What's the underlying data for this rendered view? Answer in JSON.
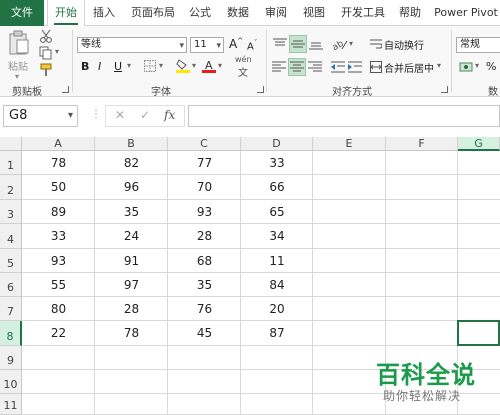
{
  "tabs": [
    {
      "label": "文件"
    },
    {
      "label": "开始"
    },
    {
      "label": "插入"
    },
    {
      "label": "页面布局"
    },
    {
      "label": "公式"
    },
    {
      "label": "数据"
    },
    {
      "label": "审阅"
    },
    {
      "label": "视图"
    },
    {
      "label": "开发工具"
    },
    {
      "label": "帮助"
    },
    {
      "label": "Power Pivot"
    }
  ],
  "ribbon": {
    "paste_label": "粘贴",
    "clipboard_group": "剪贴板",
    "font_name": "等线",
    "font_size": "11",
    "grow_font": "A",
    "shrink_font": "A",
    "bold": "B",
    "italic": "I",
    "underline": "U",
    "wen_label": "wén",
    "font_group": "字体",
    "wrap_text": "自动换行",
    "merge_center": "合并后居中",
    "align_group": "对齐方式",
    "number_format": "常规",
    "percent": "%",
    "number_group": "数"
  },
  "formula_bar": {
    "name_box": "G8",
    "cancel": "✕",
    "confirm": "✓",
    "fx": "fx",
    "formula": ""
  },
  "sheet": {
    "columns": [
      "A",
      "B",
      "C",
      "D",
      "E",
      "F",
      "G"
    ],
    "rows": [
      "1",
      "2",
      "3",
      "4",
      "5",
      "6",
      "7",
      "8",
      "9",
      "10",
      "11"
    ],
    "selected_cell": "G8",
    "data": [
      [
        "78",
        "82",
        "77",
        "33"
      ],
      [
        "50",
        "96",
        "70",
        "66"
      ],
      [
        "89",
        "35",
        "93",
        "65"
      ],
      [
        "33",
        "24",
        "28",
        "34"
      ],
      [
        "93",
        "91",
        "68",
        "11"
      ],
      [
        "55",
        "97",
        "35",
        "84"
      ],
      [
        "80",
        "28",
        "76",
        "20"
      ],
      [
        "22",
        "78",
        "45",
        "87"
      ]
    ]
  },
  "watermark": {
    "title": "百科全说",
    "subtitle": "助你轻松解决"
  },
  "colors": {
    "accent": "#217346",
    "watermark": "#1a9a4a"
  }
}
